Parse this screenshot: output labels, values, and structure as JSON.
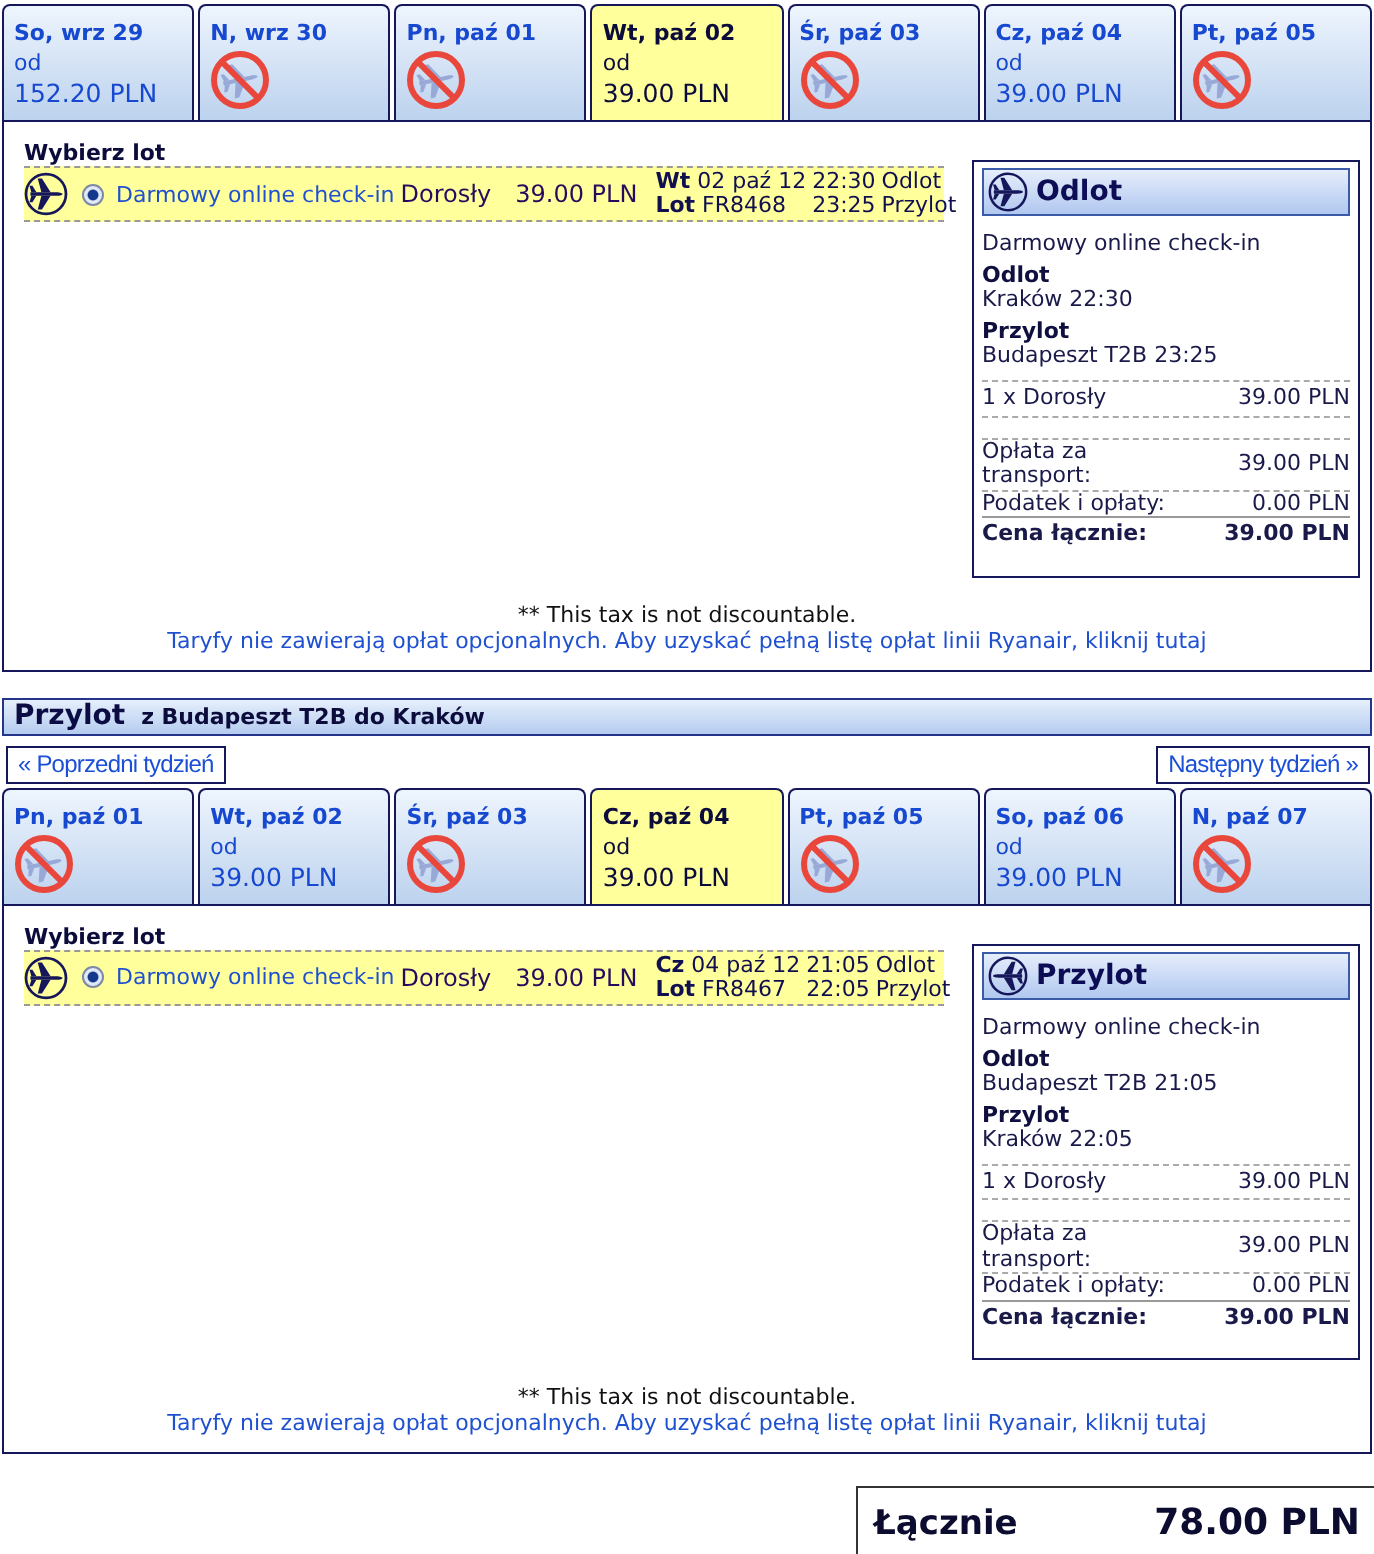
{
  "sections": [
    {
      "kind": "outbound",
      "days": [
        {
          "label": "So, wrz 29",
          "available": true,
          "from": "od",
          "price": "152.20 PLN",
          "selected": false
        },
        {
          "label": "N, wrz 30",
          "available": false,
          "selected": false
        },
        {
          "label": "Pn, paź 01",
          "available": false,
          "selected": false
        },
        {
          "label": "Wt, paź 02",
          "available": true,
          "from": "od",
          "price": "39.00 PLN",
          "selected": true
        },
        {
          "label": "Śr, paź 03",
          "available": false,
          "selected": false
        },
        {
          "label": "Cz, paź 04",
          "available": true,
          "from": "od",
          "price": "39.00 PLN",
          "selected": false
        },
        {
          "label": "Pt, paź 05",
          "available": false,
          "selected": false
        }
      ],
      "choose_label": "Wybierz lot",
      "flights": [
        {
          "selected": true,
          "fare": "Darmowy online check-in",
          "passenger": "Dorosły",
          "price": "39.00 PLN",
          "date": "**Wt** 02 paź 12",
          "flight_number": "**Lot** FR8468",
          "departure_time": "22:30",
          "departure_label": "Odlot",
          "arrival_time": "23:25",
          "arrival_label": "Przylot"
        }
      ],
      "summary": {
        "title": "Odlot",
        "fare": "Darmowy online check-in",
        "departure_heading": "Odlot",
        "departure": "Kraków 22:30",
        "arrival_heading": "Przylot",
        "arrival": "Budapeszt T2B 23:25",
        "lines": [
          {
            "label": "1 x Dorosły",
            "amount": "39.00 PLN"
          }
        ],
        "costs": [
          {
            "label": "Opłata za transport:",
            "amount": "39.00 PLN"
          },
          {
            "label": "Podatek i opłaty:",
            "amount": "0.00 PLN"
          }
        ],
        "total": {
          "label": "Cena łącznie:",
          "amount": "39.00 PLN"
        }
      },
      "tax_note": "** This tax is not discountable.",
      "fees_link": "Taryfy nie zawierają opłat opcjonalnych. Aby uzyskać pełną listę opłat linii Ryanair, kliknij tutaj"
    },
    {
      "kind": "return",
      "header": {
        "title": "Przylot",
        "route": "z Budapeszt T2B do Kraków"
      },
      "nav": {
        "previous": "« Poprzedni tydzień",
        "next": "Następny tydzień »"
      },
      "days": [
        {
          "label": "Pn, paź 01",
          "available": false,
          "selected": false
        },
        {
          "label": "Wt, paź 02",
          "available": true,
          "from": "od",
          "price": "39.00 PLN",
          "selected": false
        },
        {
          "label": "Śr, paź 03",
          "available": false,
          "selected": false
        },
        {
          "label": "Cz, paź 04",
          "available": true,
          "from": "od",
          "price": "39.00 PLN",
          "selected": true
        },
        {
          "label": "Pt, paź 05",
          "available": false,
          "selected": false
        },
        {
          "label": "So, paź 06",
          "available": true,
          "from": "od",
          "price": "39.00 PLN",
          "selected": false
        },
        {
          "label": "N, paź 07",
          "available": false,
          "selected": false
        }
      ],
      "choose_label": "Wybierz lot",
      "flights": [
        {
          "selected": true,
          "fare": "Darmowy online check-in",
          "passenger": "Dorosły",
          "price": "39.00 PLN",
          "date": "**Cz** 04 paź 12",
          "flight_number": "**Lot** FR8467",
          "departure_time": "21:05",
          "departure_label": "Odlot",
          "arrival_time": "22:05",
          "arrival_label": "Przylot"
        }
      ],
      "summary": {
        "title": "Przylot",
        "fare": "Darmowy online check-in",
        "departure_heading": "Odlot",
        "departure": "Budapeszt T2B 21:05",
        "arrival_heading": "Przylot",
        "arrival": "Kraków 22:05",
        "lines": [
          {
            "label": "1 x Dorosły",
            "amount": "39.00 PLN"
          }
        ],
        "costs": [
          {
            "label": "Opłata za transport:",
            "amount": "39.00 PLN"
          },
          {
            "label": "Podatek i opłaty:",
            "amount": "0.00 PLN"
          }
        ],
        "total": {
          "label": "Cena łącznie:",
          "amount": "39.00 PLN"
        }
      },
      "tax_note": "** This tax is not discountable.",
      "fees_link": "Taryfy nie zawierają opłat opcjonalnych. Aby uzyskać pełną listę opłat linii Ryanair, kliknij tutaj"
    }
  ],
  "grand_total": {
    "label": "Łącznie",
    "amount": "78.00 PLN"
  }
}
